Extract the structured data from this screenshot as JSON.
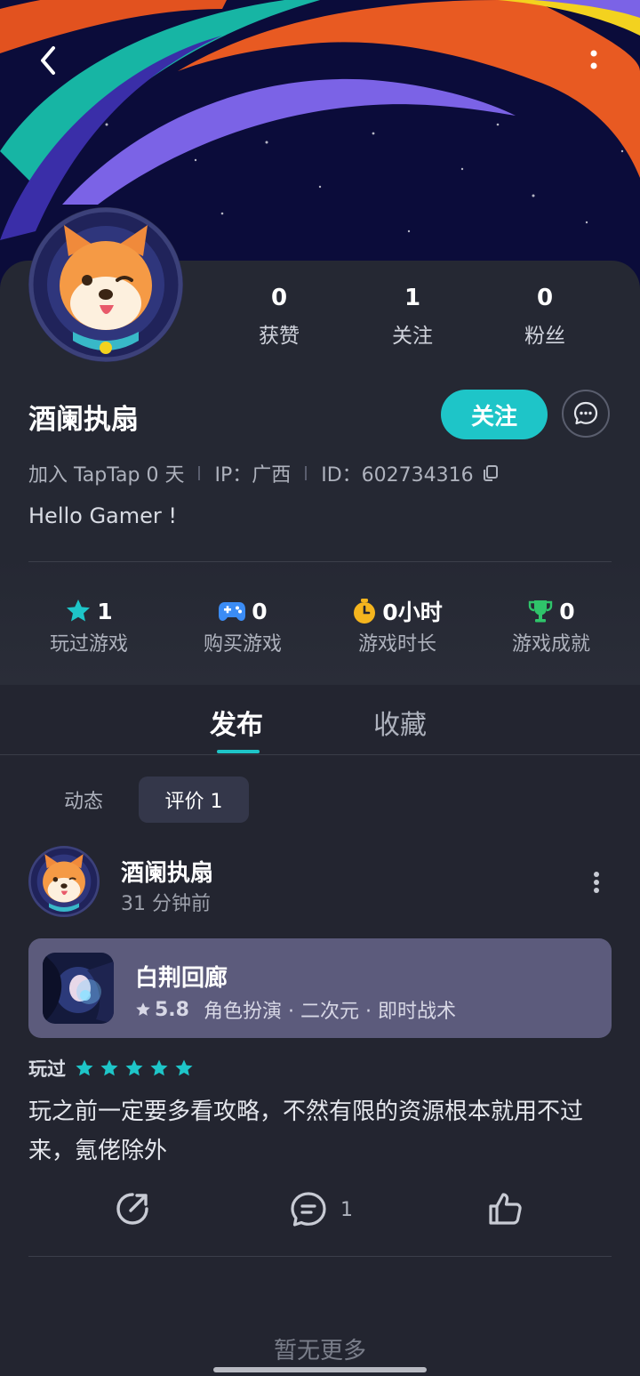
{
  "header": {
    "back_icon": "back-arrow-icon",
    "more_icon": "more-vertical-icon"
  },
  "profile": {
    "username": "酒阑执扇",
    "stats": [
      {
        "value": "0",
        "label": "获赞"
      },
      {
        "value": "1",
        "label": "关注"
      },
      {
        "value": "0",
        "label": "粉丝"
      }
    ],
    "follow_label": "关注",
    "joined": "加入 TapTap 0 天",
    "ip": "IP：广西",
    "id": "ID：602734316",
    "bio": "Hello Gamer !"
  },
  "game_stats": [
    {
      "icon": "star-icon",
      "value": "1",
      "label": "玩过游戏",
      "color": "#1ec5c8"
    },
    {
      "icon": "gamepad-icon",
      "value": "0",
      "label": "购买游戏",
      "color": "#3b8cf5"
    },
    {
      "icon": "stopwatch-icon",
      "value": "0小时",
      "label": "游戏时长",
      "color": "#f5b51e"
    },
    {
      "icon": "trophy-icon",
      "value": "0",
      "label": "游戏成就",
      "color": "#2fc46a"
    }
  ],
  "tabs": {
    "publish": "发布",
    "favorites": "收藏"
  },
  "subtabs": {
    "dynamic": "动态",
    "reviews": "评价 1"
  },
  "post": {
    "author": "酒阑执扇",
    "time": "31 分钟前",
    "game": {
      "name": "白荆回廊",
      "rating": "5.8",
      "tags": "角色扮演 · 二次元 · 即时战术"
    },
    "played_label": "玩过",
    "stars": 5,
    "text": "玩之前一定要多看攻略，不然有限的资源根本就用不过来，氪佬除外",
    "comment_count": "1"
  },
  "footer": {
    "no_more": "暂无更多"
  },
  "colors": {
    "accent": "#1ec5c8",
    "background": "#232530",
    "card": "#5c5b7c"
  }
}
